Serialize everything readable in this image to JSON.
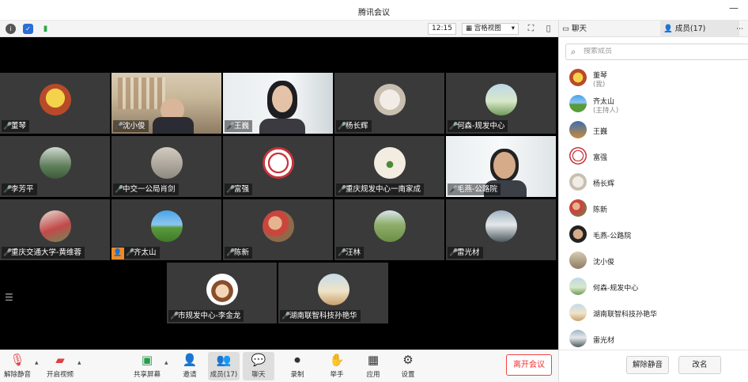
{
  "window": {
    "title": "腾讯会议"
  },
  "toolbar": {
    "time": "12:15",
    "view_label": "宫格视图"
  },
  "tiles": [
    {
      "name": "董琴"
    },
    {
      "name": "沈小俊"
    },
    {
      "name": "王巍"
    },
    {
      "name": "杨长辉"
    },
    {
      "name": "何森-规发中心"
    },
    {
      "name": "李芳平"
    },
    {
      "name": "中交一公局肖剑"
    },
    {
      "name": "富强"
    },
    {
      "name": "重庆规发中心一南家成"
    },
    {
      "name": "毛燕-公路院"
    },
    {
      "name": "重庆交通大学-黄维蓉"
    },
    {
      "name": "齐太山"
    },
    {
      "name": "陈新"
    },
    {
      "name": "汪林"
    },
    {
      "name": "雷光材"
    },
    {
      "name": "市规发中心-李金龙"
    },
    {
      "name": "湖南联智科技孙艳华"
    }
  ],
  "bottombar": {
    "unmute": "解除静音",
    "video": "开启视频",
    "share": "共享屏幕",
    "invite": "邀请",
    "members": "成员(17)",
    "chat": "聊天",
    "record": "录制",
    "raise": "举手",
    "apps": "应用",
    "settings": "设置",
    "leave": "离开会议"
  },
  "panel": {
    "tab_chat": "聊天",
    "tab_members": "成员(17)",
    "search_placeholder": "搜索成员",
    "members": [
      {
        "name": "董琴",
        "sub": "(我)"
      },
      {
        "name": "齐太山",
        "sub": "(主持人)"
      },
      {
        "name": "王巍"
      },
      {
        "name": "富强"
      },
      {
        "name": "杨长辉"
      },
      {
        "name": "陈新"
      },
      {
        "name": "毛燕-公路院"
      },
      {
        "name": "沈小俊"
      },
      {
        "name": "何森-规发中心"
      },
      {
        "name": "湖南联智科技孙艳华"
      },
      {
        "name": "雷光材"
      }
    ],
    "unmute_all": "解除静音",
    "rename": "改名"
  }
}
